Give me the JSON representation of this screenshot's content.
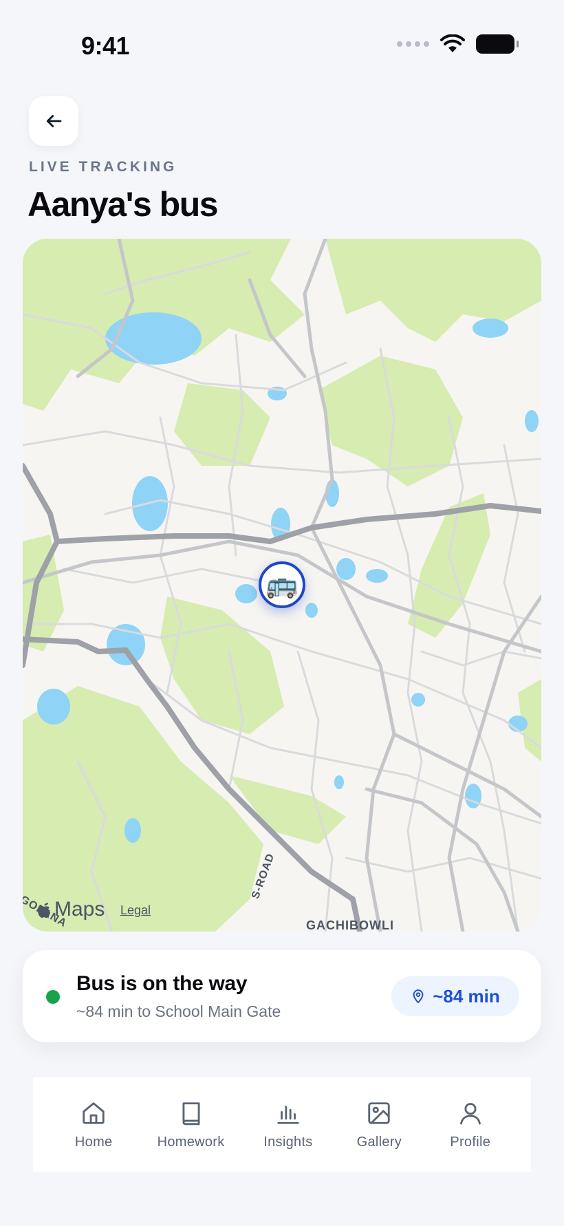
{
  "status_bar": {
    "time": "9:41"
  },
  "header": {
    "back_icon": "arrow-left-icon",
    "eyebrow": "LIVE TRACKING",
    "title": "Aanya's bus"
  },
  "map": {
    "provider_label": "Maps",
    "legal_label": "Legal",
    "marker_icon": "bus-icon",
    "marker_emoji": "🚌",
    "road_labels": [
      "S-ROAD",
      "GACHIBOWLI",
      "GOPANA"
    ],
    "colors": {
      "land": "#f6f5f1",
      "park": "#d6ecb0",
      "water": "#8fd3f7",
      "highway": "#9ea1a8",
      "road": "#d9dadd"
    }
  },
  "trip_status": {
    "title": "Bus is on the way",
    "subtitle": "~84 min to School Main Gate",
    "eta_icon": "map-pin-icon",
    "eta": "~84 min",
    "status_color": "#16a34a"
  },
  "tab_bar": {
    "items": [
      {
        "label": "Home",
        "icon": "home-icon"
      },
      {
        "label": "Homework",
        "icon": "book-icon"
      },
      {
        "label": "Insights",
        "icon": "bar-chart-icon"
      },
      {
        "label": "Gallery",
        "icon": "image-icon"
      },
      {
        "label": "Profile",
        "icon": "user-icon"
      }
    ]
  }
}
